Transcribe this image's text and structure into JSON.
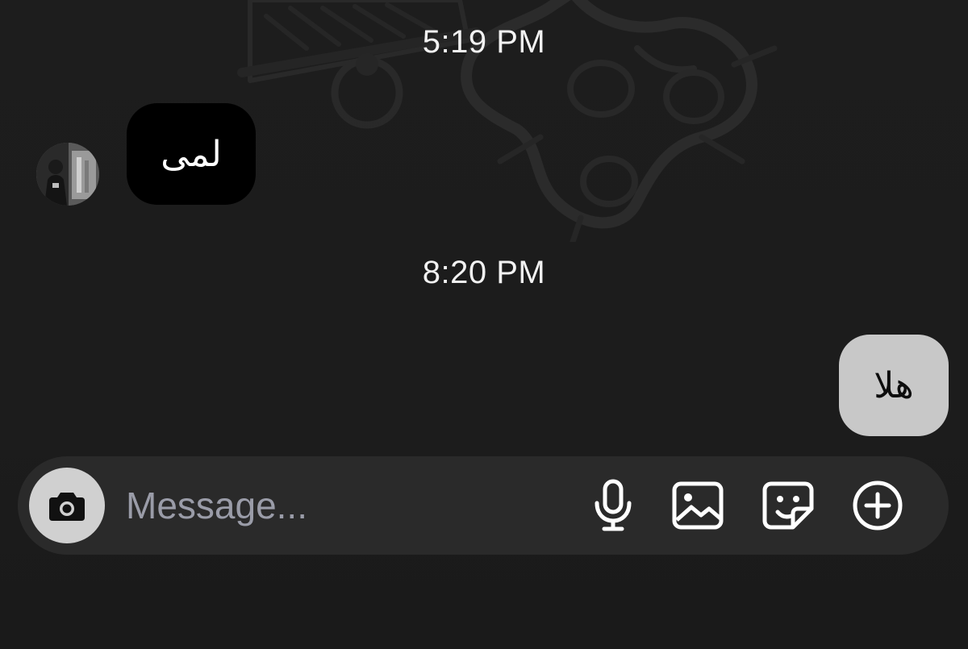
{
  "thread": {
    "messages": [
      {
        "time": "5:19 PM",
        "text": "لمى",
        "direction": "incoming"
      },
      {
        "time": "8:20 PM",
        "text": "هلا",
        "direction": "outgoing"
      }
    ]
  },
  "composer": {
    "placeholder": "Message...",
    "value": "",
    "icons": [
      "camera-icon",
      "microphone-icon",
      "gallery-icon",
      "sticker-icon",
      "plus-circle-icon"
    ]
  },
  "colors": {
    "background": "#1c1c1c",
    "incoming_bubble": "#000000",
    "outgoing_bubble": "#c8c8c8",
    "composer_bar": "#2a2a2a",
    "camera_button": "#d0d0d0",
    "placeholder_text": "#9a9ca8"
  }
}
